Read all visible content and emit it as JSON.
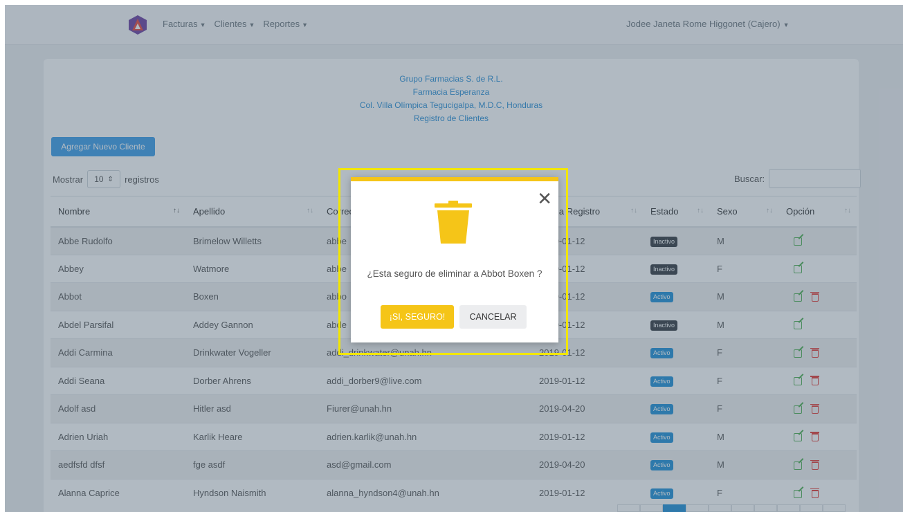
{
  "navbar": {
    "menus": [
      "Facturas",
      "Clientes",
      "Reportes"
    ],
    "user": "Jodee Janeta Rome Higgonet (Cajero)"
  },
  "header": {
    "lines": [
      "Grupo Farmacias S. de R.L.",
      "Farmacia Esperanza",
      "Col. Villa Olímpica Tegucigalpa, M.D.C, Honduras",
      "Registro de Clientes"
    ]
  },
  "controls": {
    "add_label": "Agregar Nuevo Cliente",
    "show_label": "Mostrar",
    "page_length": "10",
    "records_label": "registros",
    "search_label": "Buscar:"
  },
  "table": {
    "columns": [
      "Nombre",
      "Apellido",
      "Correo",
      "Fecha Registro",
      "Estado",
      "Sexo",
      "Opción"
    ],
    "rows": [
      {
        "nombre": "Abbe Rudolfo",
        "apellido": "Brimelow Willetts",
        "correo": "abbe",
        "fecha": "2019-01-12",
        "estado": "Inactivo",
        "sexo": "M",
        "delete": false
      },
      {
        "nombre": "Abbey",
        "apellido": "Watmore",
        "correo": "abbe",
        "fecha": "2019-01-12",
        "estado": "Inactivo",
        "sexo": "F",
        "delete": false
      },
      {
        "nombre": "Abbot",
        "apellido": "Boxen",
        "correo": "abbo",
        "fecha": "2019-01-12",
        "estado": "Activo",
        "sexo": "M",
        "delete": true
      },
      {
        "nombre": "Abdel Parsifal",
        "apellido": "Addey Gannon",
        "correo": "abde",
        "fecha": "2019-01-12",
        "estado": "Inactivo",
        "sexo": "M",
        "delete": false
      },
      {
        "nombre": "Addi Carmina",
        "apellido": "Drinkwater Vogeller",
        "correo": "addi_drinkwater@unah.hn",
        "fecha": "2019-01-12",
        "estado": "Activo",
        "sexo": "F",
        "delete": true
      },
      {
        "nombre": "Addi Seana",
        "apellido": "Dorber Ahrens",
        "correo": "addi_dorber9@live.com",
        "fecha": "2019-01-12",
        "estado": "Activo",
        "sexo": "F",
        "delete": true
      },
      {
        "nombre": "Adolf asd",
        "apellido": "Hitler asd",
        "correo": "Fiurer@unah.hn",
        "fecha": "2019-04-20",
        "estado": "Activo",
        "sexo": "F",
        "delete": true
      },
      {
        "nombre": "Adrien Uriah",
        "apellido": "Karlik Heare",
        "correo": "adrien.karlik@unah.hn",
        "fecha": "2019-01-12",
        "estado": "Activo",
        "sexo": "M",
        "delete": true
      },
      {
        "nombre": "aedfsfd dfsf",
        "apellido": "fge asdf",
        "correo": "asd@gmail.com",
        "fecha": "2019-04-20",
        "estado": "Activo",
        "sexo": "M",
        "delete": true
      },
      {
        "nombre": "Alanna Caprice",
        "apellido": "Hyndson Naismith",
        "correo": "alanna_hyndson4@unah.hn",
        "fecha": "2019-01-12",
        "estado": "Activo",
        "sexo": "F",
        "delete": true
      }
    ]
  },
  "modal": {
    "message": "¿Esta seguro de eliminar a Abbot Boxen ?",
    "confirm_label": "¡SI, SEGURO!",
    "cancel_label": "CANCELAR",
    "close_glyph": "✕"
  },
  "colors": {
    "warning": "#f5c518",
    "primary": "#3c9de8",
    "highlight": "#f2e600"
  },
  "icons": {
    "logo": "app-logo-icon",
    "trash": "trash-icon",
    "edit": "edit-icon",
    "delete": "delete-icon"
  }
}
